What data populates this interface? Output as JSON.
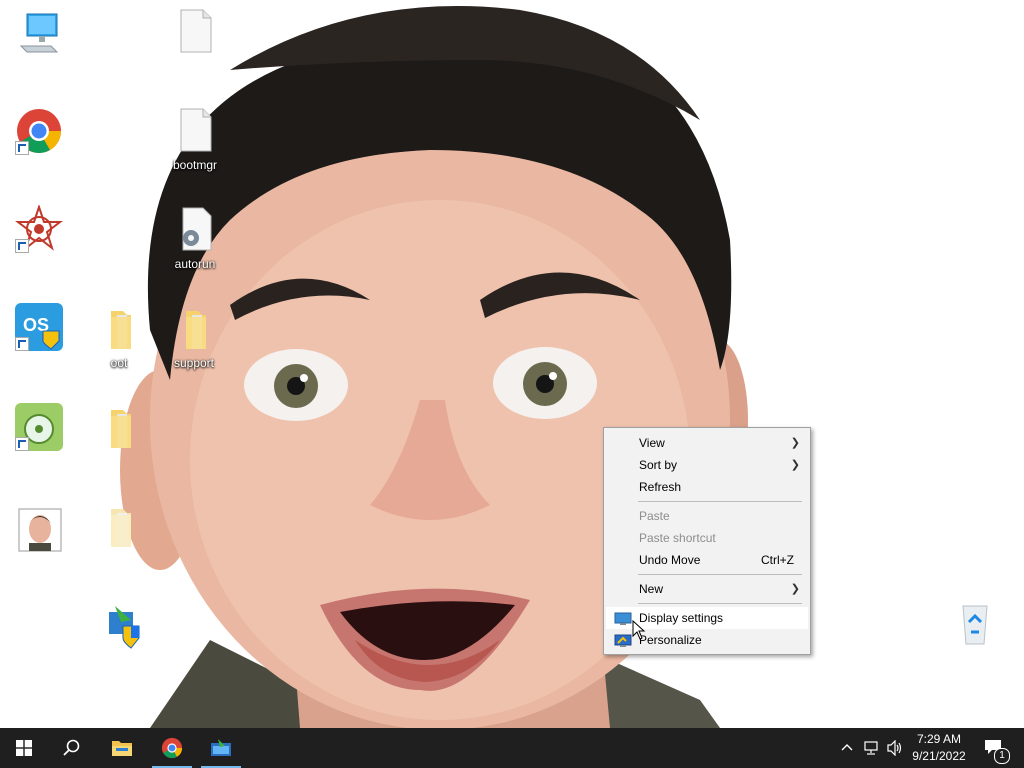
{
  "desktop": {
    "icons": [
      {
        "label": ""
      },
      {
        "label": ""
      },
      {
        "label": ""
      },
      {
        "label": ""
      },
      {
        "label": ""
      },
      {
        "label": ""
      },
      {
        "label": ""
      },
      {
        "label": "bootmgr"
      },
      {
        "label": "autorun"
      },
      {
        "label": "oot"
      },
      {
        "label": "support"
      },
      {
        "label": ""
      },
      {
        "label": ""
      },
      {
        "label": ""
      },
      {
        "label": ""
      }
    ]
  },
  "context_menu": {
    "items": [
      {
        "label": "View"
      },
      {
        "label": "Sort by"
      },
      {
        "label": "Refresh"
      },
      {
        "label": "Paste"
      },
      {
        "label": "Paste shortcut"
      },
      {
        "label": "Undo Move",
        "shortcut": "Ctrl+Z"
      },
      {
        "label": "New"
      },
      {
        "label": "Display settings"
      },
      {
        "label": "Personalize"
      }
    ]
  },
  "taskbar": {
    "clock_time": "7:29 AM",
    "clock_date": "9/21/2022",
    "notification_count": "1"
  },
  "colors": {
    "taskbar_bg": "#1f1f1f",
    "menu_bg": "#f2f2f2",
    "accent": "#76b9ed"
  }
}
